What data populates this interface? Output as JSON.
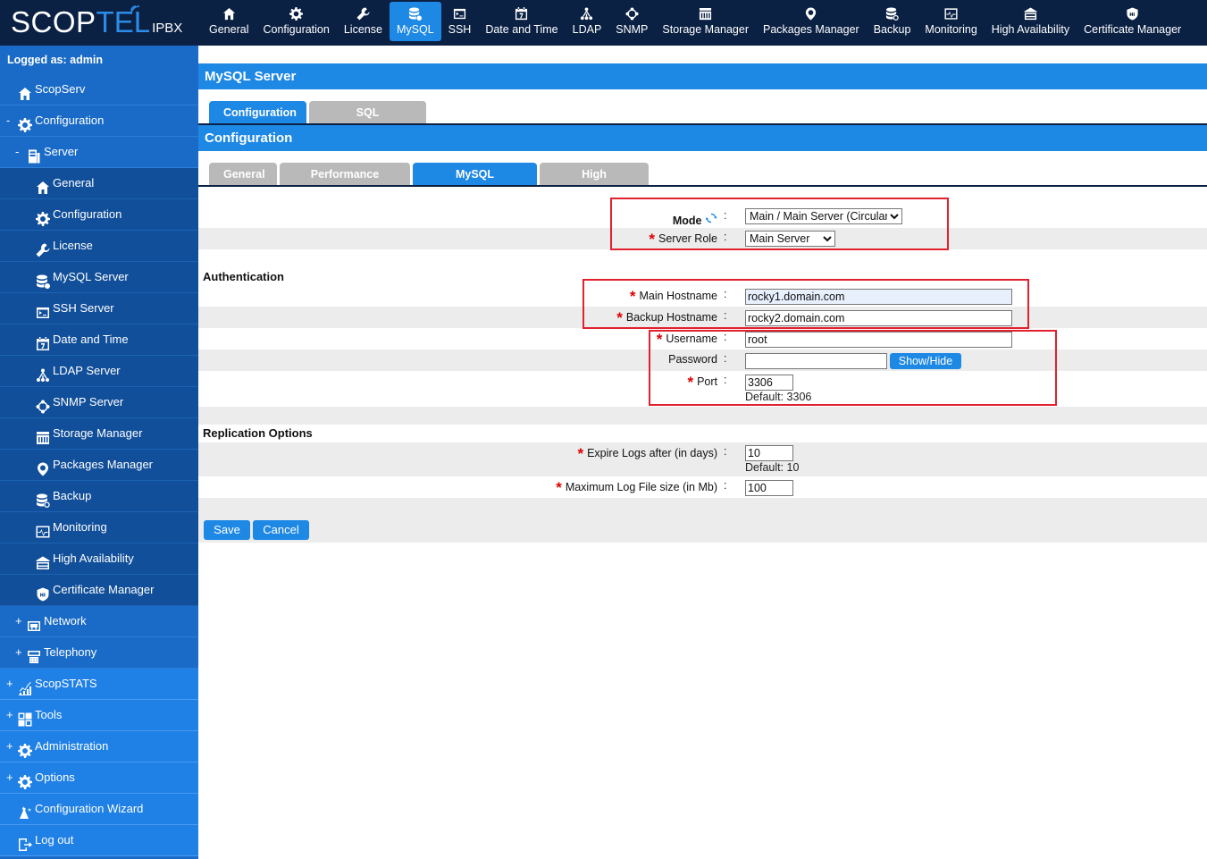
{
  "logo": {
    "scop": "SCOP",
    "tel": "TEL",
    "ipbx": "IPBX"
  },
  "topnav": [
    {
      "label": "General",
      "icon": "home-icon"
    },
    {
      "label": "Configuration",
      "icon": "gear-icon"
    },
    {
      "label": "License",
      "icon": "wrench-icon"
    },
    {
      "label": "MySQL",
      "icon": "database-icon",
      "active": true
    },
    {
      "label": "SSH",
      "icon": "terminal-icon"
    },
    {
      "label": "Date and Time",
      "icon": "calendar-icon"
    },
    {
      "label": "LDAP",
      "icon": "tree-icon"
    },
    {
      "label": "SNMP",
      "icon": "network-ring-icon"
    },
    {
      "label": "Storage Manager",
      "icon": "storage-icon"
    },
    {
      "label": "Packages Manager",
      "icon": "package-icon"
    },
    {
      "label": "Backup",
      "icon": "backup-icon"
    },
    {
      "label": "Monitoring",
      "icon": "monitor-icon"
    },
    {
      "label": "High Availability",
      "icon": "ha-icon"
    },
    {
      "label": "Certificate Manager",
      "icon": "shield-icon"
    }
  ],
  "sidebar": {
    "logged": "Logged as: admin",
    "items": [
      {
        "toggle": "",
        "label": "ScopServ",
        "icon": "home-icon",
        "level": 0
      },
      {
        "toggle": "-",
        "label": "Configuration",
        "icon": "gear-icon",
        "level": 0
      },
      {
        "toggle": "-",
        "label": "Server",
        "icon": "server-icon",
        "level": 1
      },
      {
        "toggle": "",
        "label": "General",
        "icon": "home-icon",
        "level": 2
      },
      {
        "toggle": "",
        "label": "Configuration",
        "icon": "gear-icon",
        "level": 2
      },
      {
        "toggle": "",
        "label": "License",
        "icon": "wrench-icon",
        "level": 2
      },
      {
        "toggle": "",
        "label": "MySQL Server",
        "icon": "database-icon",
        "level": 2
      },
      {
        "toggle": "",
        "label": "SSH Server",
        "icon": "terminal-icon",
        "level": 2
      },
      {
        "toggle": "",
        "label": "Date and Time",
        "icon": "calendar-icon",
        "level": 2
      },
      {
        "toggle": "",
        "label": "LDAP Server",
        "icon": "tree-icon",
        "level": 2
      },
      {
        "toggle": "",
        "label": "SNMP Server",
        "icon": "network-ring-icon",
        "level": 2
      },
      {
        "toggle": "",
        "label": "Storage Manager",
        "icon": "storage-icon",
        "level": 2
      },
      {
        "toggle": "",
        "label": "Packages Manager",
        "icon": "package-icon",
        "level": 2
      },
      {
        "toggle": "",
        "label": "Backup",
        "icon": "backup-icon",
        "level": 2
      },
      {
        "toggle": "",
        "label": "Monitoring",
        "icon": "monitor-icon",
        "level": 2
      },
      {
        "toggle": "",
        "label": "High Availability",
        "icon": "ha-icon",
        "level": 2
      },
      {
        "toggle": "",
        "label": "Certificate Manager",
        "icon": "shield-icon",
        "level": 2
      },
      {
        "toggle": "+",
        "label": "Network",
        "icon": "network-icon",
        "level": 1
      },
      {
        "toggle": "+",
        "label": "Telephony",
        "icon": "telephony-icon",
        "level": 1
      },
      {
        "toggle": "+",
        "label": "ScopSTATS",
        "icon": "chart-icon",
        "level": 0
      },
      {
        "toggle": "+",
        "label": "Tools",
        "icon": "tools-icon",
        "level": 0
      },
      {
        "toggle": "+",
        "label": "Administration",
        "icon": "admin-gear-icon",
        "level": 0
      },
      {
        "toggle": "+",
        "label": "Options",
        "icon": "gear-icon",
        "level": 0
      },
      {
        "toggle": "",
        "label": "Configuration Wizard",
        "icon": "wizard-icon",
        "level": 0
      },
      {
        "toggle": "",
        "label": "Log out",
        "icon": "logout-icon",
        "level": 0
      }
    ]
  },
  "main": {
    "title": "MySQL Server",
    "top_tabs": [
      {
        "label": "Configuration",
        "active": true
      },
      {
        "label": "SQL Permissions",
        "active": false
      }
    ],
    "subtitle": "Configuration",
    "sub_tabs": [
      {
        "label": "General",
        "active": false
      },
      {
        "label": "Performance Tuning",
        "active": false
      },
      {
        "label": "MySQL Replication",
        "active": true
      },
      {
        "label": "High Availability",
        "active": false
      }
    ],
    "form": {
      "mode_label": "Mode",
      "mode_value": "Main / Main Server (Circular)",
      "server_role_label": "Server Role",
      "server_role_value": "Main Server",
      "auth_section": "Authentication",
      "main_hostname_label": "Main Hostname",
      "main_hostname_value": "rocky1.domain.com",
      "backup_hostname_label": "Backup Hostname",
      "backup_hostname_value": "rocky2.domain.com",
      "username_label": "Username",
      "username_value": "root",
      "password_label": "Password",
      "password_value": "",
      "showhide_label": "Show/Hide",
      "port_label": "Port",
      "port_value": "3306",
      "port_default": "Default: 3306",
      "repl_section": "Replication Options",
      "expire_label": "Expire Logs after (in days)",
      "expire_value": "10",
      "expire_default": "Default: 10",
      "maxlog_label": "Maximum Log File size (in Mb)",
      "maxlog_value": "100",
      "colon": ":",
      "req": "*"
    },
    "buttons": {
      "save": "Save",
      "cancel": "Cancel"
    }
  }
}
